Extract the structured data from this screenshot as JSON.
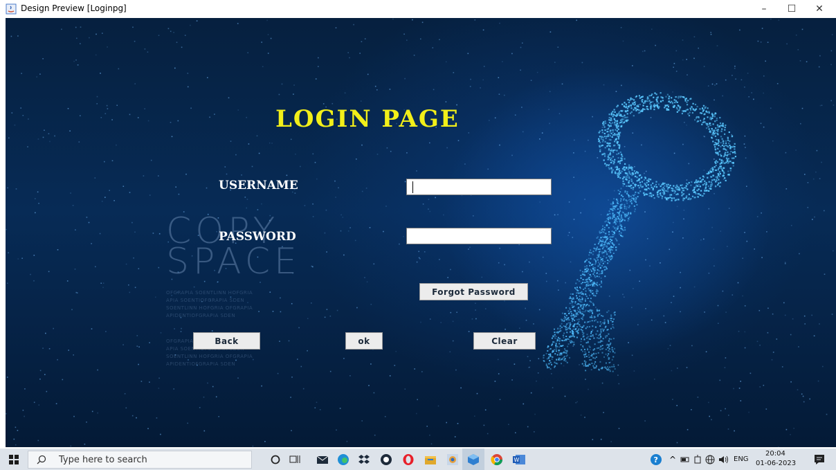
{
  "window": {
    "title": "Design Preview [Loginpg]",
    "minimize_glyph": "–",
    "maximize_glyph": "☐",
    "close_glyph": "✕"
  },
  "background": {
    "watermark_line1": "COPY",
    "watermark_line2": "SPACE",
    "watermark_small_1": [
      "OFGRAPIA SOENTLINN HOFGRIA",
      "APIA SOENTIOFGRAPIA SDEN",
      "SOENTLINN HOFGRIA OFGRAPIA",
      "APIDENTIOFGRAPIA SDEN"
    ],
    "watermark_small_2": [
      "OFGRAPIA SOENTLINN HOFGRIA",
      "APIA SOENTIOFGRAPIA SDEN",
      "SOENTLINN HOFGRIA OFGRAPIA",
      "APIDENTIOFGRAPIA SDEN"
    ]
  },
  "form": {
    "title": "LOGIN PAGE",
    "username_label": "USERNAME",
    "username_value": "",
    "password_label": "PASSWORD",
    "password_value": "",
    "forgot_label": "Forgot Password",
    "back_label": "Back",
    "ok_label": "ok",
    "clear_label": "Clear"
  },
  "taskbar": {
    "search_placeholder": "Type here to search",
    "language": "ENG",
    "time": "20:04",
    "date": "01-06-2023",
    "icons": [
      "windows-start-icon",
      "cortana-icon",
      "task-view-icon",
      "mail-icon",
      "edge-icon",
      "dropbox-icon",
      "app-icon",
      "opera-icon",
      "file-explorer-icon",
      "netbeans-icon",
      "virtualbox-icon",
      "chrome-icon",
      "word-icon"
    ]
  },
  "colors": {
    "title": "#f2ef19",
    "label": "#ffffff",
    "background": "#072b56"
  }
}
